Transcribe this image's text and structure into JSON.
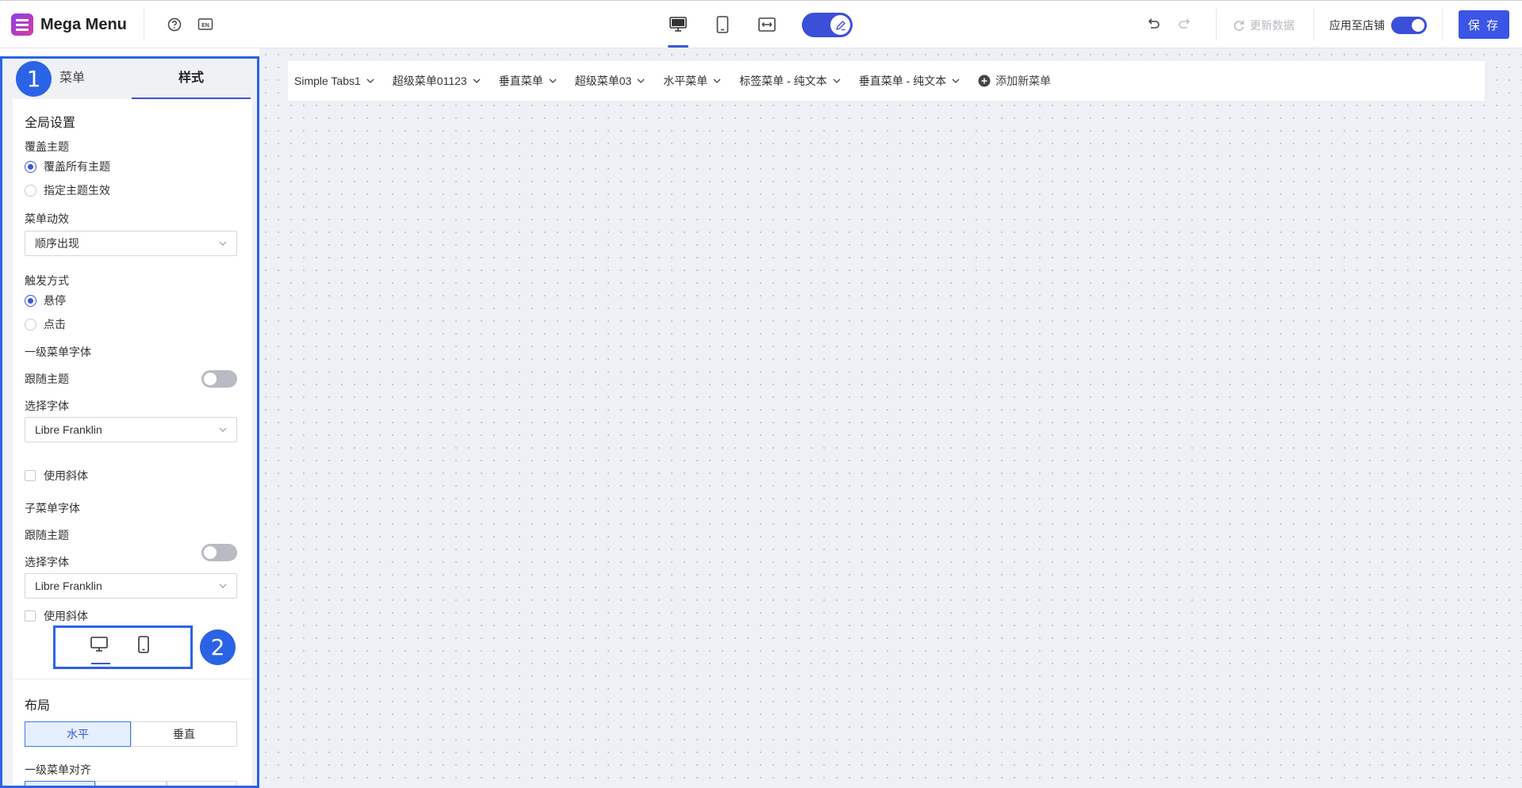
{
  "header": {
    "app_title": "Mega Menu",
    "help_icon": "help-circle-icon",
    "lang_icon": "language-en-icon",
    "lang_label": "EN",
    "devices": [
      "desktop-icon",
      "tablet-icon",
      "fit-width-icon"
    ],
    "active_device": "desktop",
    "edit_toggle_on": true,
    "refresh_label": "更新数据",
    "apply_label": "应用至店铺",
    "apply_toggle_on": true,
    "save_label": "保 存",
    "accent_color": "#3b55e6"
  },
  "menu_bar": {
    "items": [
      "Simple Tabs1",
      "超级菜单01123",
      "垂直菜单",
      "超级菜单03",
      "水平菜单",
      "标签菜单 - 纯文本",
      "垂直菜单 - 纯文本"
    ],
    "add_label": "添加新菜单"
  },
  "sidebar": {
    "tabs": [
      "菜单",
      "样式"
    ],
    "active_tab": "样式",
    "badge_1": "1",
    "badge_2": "2",
    "global_title": "全局设置",
    "override_theme_label": "覆盖主题",
    "override_options": [
      "覆盖所有主题",
      "指定主题生效"
    ],
    "override_selected": "覆盖所有主题",
    "animation_label": "菜单动效",
    "animation_value": "顺序出现",
    "trigger_label": "触发方式",
    "trigger_options": [
      "悬停",
      "点击"
    ],
    "trigger_selected": "悬停",
    "level1_font_label": "一级菜单字体",
    "follow_theme_label": "跟随主题",
    "choose_font_label": "选择字体",
    "level1_font_value": "Libre Franklin",
    "italic_label": "使用斜体",
    "sub_font_label": "子菜单字体",
    "sub_font_value": "Libre Franklin",
    "layout_title": "布局",
    "layout_options": [
      "水平",
      "垂直"
    ],
    "layout_selected": "水平",
    "align_label": "一级菜单对齐"
  }
}
